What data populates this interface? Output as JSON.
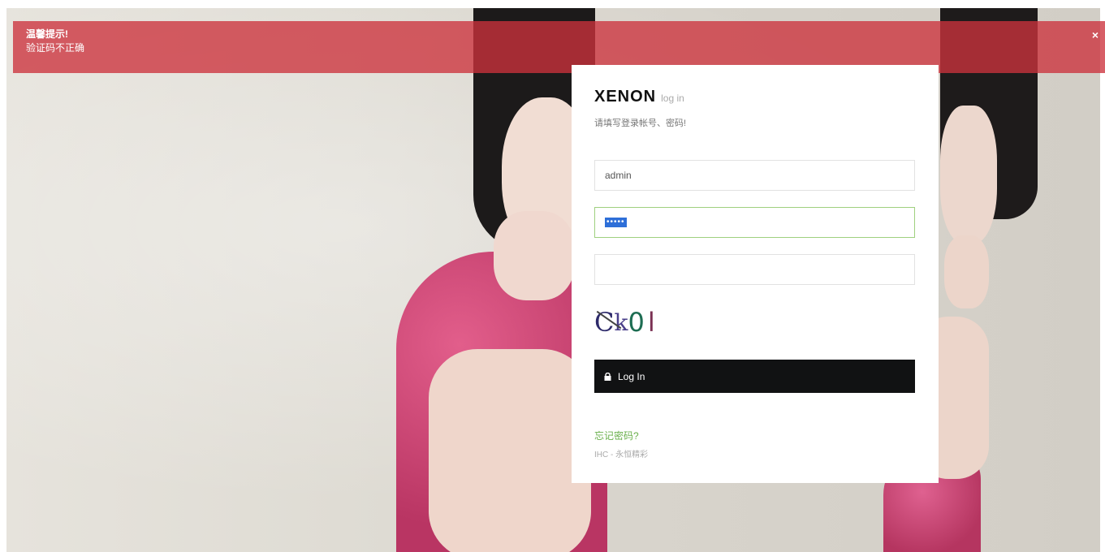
{
  "alert": {
    "title": "温馨提示!",
    "message": "验证码不正确",
    "close_label": "×",
    "color": "#cc323c"
  },
  "login": {
    "logo": "XENON",
    "logo_sub": "log in",
    "hint": "请填写登录帐号、密码!",
    "username_value": "admin",
    "password_mask": "•••••",
    "captcha_chars": [
      "C",
      "k",
      "0",
      "l"
    ],
    "button_label": "Log In",
    "button_icon": "lock-icon",
    "forgot_label": "忘记密码?",
    "footer_text": "IHC - 永恒精彩",
    "accent_color": "#6ab04c"
  }
}
